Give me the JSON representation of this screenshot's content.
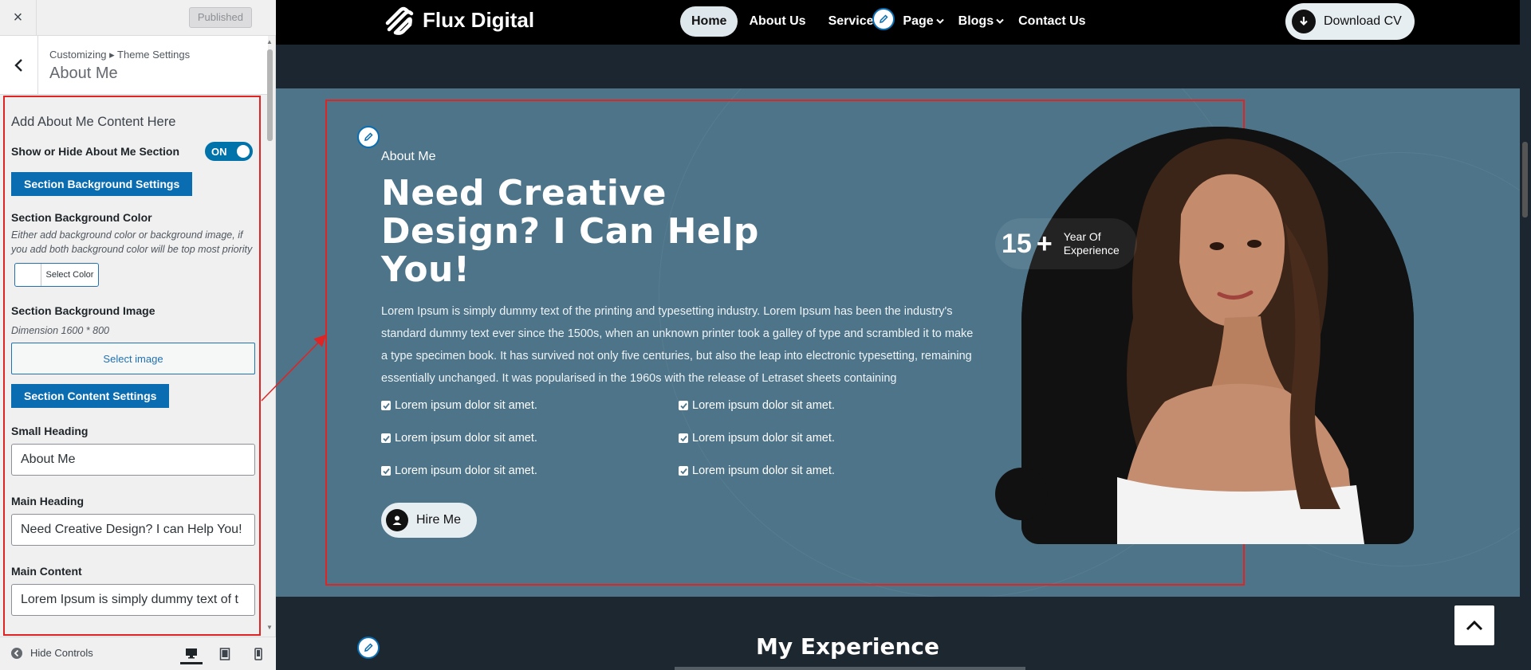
{
  "customizer": {
    "close_label": "×",
    "published_label": "Published",
    "breadcrumb": "Customizing ▸ Theme Settings",
    "section_title": "About Me",
    "panel_heading": "Add About Me Content Here",
    "show_hide_label": "Show or Hide About Me Section",
    "toggle_state": "ON",
    "bg_settings_button": "Section Background Settings",
    "bg_color_label": "Section Background Color",
    "bg_color_desc": "Either add background color or background image, if you add both background color will be top most priority",
    "select_color_label": "Select Color",
    "bg_image_label": "Section Background Image",
    "bg_image_desc": "Dimension 1600 * 800",
    "select_image_label": "Select image",
    "content_settings_button": "Section Content Settings",
    "small_heading_label": "Small Heading",
    "small_heading_value": "About Me",
    "main_heading_label": "Main Heading",
    "main_heading_value": "Need Creative Design?  I can Help You!",
    "main_content_label": "Main Content",
    "main_content_value": "Lorem Ipsum is simply dummy text of t",
    "hide_controls_label": "Hide Controls"
  },
  "site": {
    "logo_text": "Flux Digital",
    "nav": [
      "Home",
      "About Us",
      "Services",
      "Page",
      "Blogs",
      "Contact Us"
    ],
    "download_cv": "Download CV",
    "about": {
      "small_heading": "About Me",
      "heading": "Need Creative Design? I Can Help You!",
      "paragraph": "Lorem Ipsum is simply dummy text of the printing and typesetting industry. Lorem Ipsum has been the industry's standard dummy text ever since the 1500s, when an unknown printer took a galley of type and scrambled it to make a type specimen book. It has survived not only five centuries, but also the leap into electronic typesetting, remaining essentially unchanged. It was popularised in the 1960s with the release of Letraset sheets containing",
      "checklist": [
        "Lorem ipsum dolor sit amet.",
        "Lorem ipsum dolor sit amet.",
        "Lorem ipsum dolor sit amet.",
        "Lorem ipsum dolor sit amet.",
        "Lorem ipsum dolor sit amet.",
        "Lorem ipsum dolor sit amet."
      ],
      "hire_me": "Hire Me",
      "experience_number": "15",
      "experience_plus": "+",
      "experience_text": "Year Of Experience"
    },
    "experience_title": "My Experience"
  },
  "colors": {
    "accent_blue": "#0a6db1",
    "about_bg": "#4d7489",
    "highlight_red": "#e02424"
  }
}
